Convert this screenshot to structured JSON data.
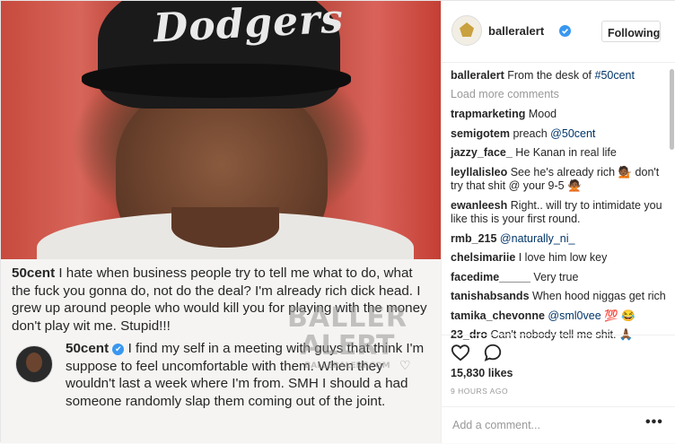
{
  "post": {
    "image_caption": {
      "username": "50cent",
      "text": " I hate when business people try to tell me what to do, what the fuck you gonna do, not do the deal? I'm already rich  dick head. I grew up around people who would kill you for playing with the money don't play wit me. Stupid!!!"
    },
    "image_comment": {
      "username": "50cent",
      "text": " I find my self in a meeting with guys that think I'm suppose to feel uncomfortable with them. When they wouldn't last a week where I'm from. SMH I should a had someone randomly slap them coming out of the joint."
    },
    "cap_text": "Dodgers",
    "watermark": {
      "line1": "BALLER",
      "line2": "ALERT",
      "line3": "BALLERALERT.COM"
    }
  },
  "header": {
    "username": "balleralert",
    "follow_label": "Following"
  },
  "caption": {
    "username": "balleralert",
    "text": " From the desk of ",
    "hashtag": "#50cent"
  },
  "load_more": "Load more comments",
  "comments": [
    {
      "user": "trapmarketing",
      "text": " Mood"
    },
    {
      "user": "semigotem",
      "text": " preach ",
      "mention": "@50cent"
    },
    {
      "user": "jazzy_face_",
      "text": " He Kanan in real life"
    },
    {
      "user": "leyllalisleo",
      "text": " See he's already rich 💁🏾 don't try that shit @ your 9-5 🙅🏾"
    },
    {
      "user": "ewanleesh",
      "text": " Right.. will try to intimidate you like this is your first round."
    },
    {
      "user": "rmb_215",
      "text": " ",
      "mention": "@naturally_ni_"
    },
    {
      "user": "chelsimariie",
      "text": " I love him low key"
    },
    {
      "user": "facedime_____",
      "text": " Very true"
    },
    {
      "user": "tanishabsands",
      "text": " When hood niggas get rich"
    },
    {
      "user": "tamika_chevonne",
      "text": " ",
      "mention": "@sml0vee",
      "suffix": " 💯 😂"
    },
    {
      "user": "23_dro",
      "text": " Can't nobody tell me shit. 🙏🏾"
    }
  ],
  "likes": "15,830 likes",
  "time": "9 HOURS AGO",
  "add_comment": {
    "placeholder": "Add a comment..."
  },
  "more_label": "•••",
  "icons": {
    "like": "heart-icon",
    "comment": "comment-icon",
    "options": "more-options-icon"
  },
  "colors": {
    "accent": "#3897f0",
    "mention": "#003569",
    "muted": "#999999"
  }
}
